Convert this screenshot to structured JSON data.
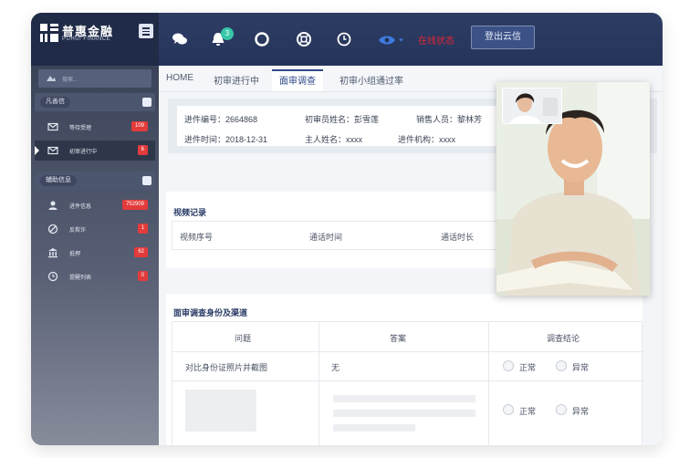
{
  "brand": {
    "name": "普惠金融",
    "sub": "PUHUI FINANCE"
  },
  "header": {
    "notification_count": "3",
    "status_text": "在线状态",
    "logout_label": "登出云信"
  },
  "sidebar": {
    "search_placeholder": "搜索...",
    "sections": [
      {
        "label": "凡善信",
        "items": [
          {
            "label": "等待受理",
            "count": "109"
          },
          {
            "label": "初审进行中",
            "count": "6"
          }
        ]
      },
      {
        "label": "辅助信息",
        "items": [
          {
            "label": "进件信息",
            "count": "752909"
          },
          {
            "label": "反欺诈",
            "count": "1"
          },
          {
            "label": "抵押",
            "count": "62"
          },
          {
            "label": "提醒列表",
            "count": "0"
          }
        ]
      }
    ]
  },
  "tabs": [
    "HOME",
    "初审进行中",
    "面审调查",
    "初审小组通过率"
  ],
  "info": {
    "id_label": "进件编号：",
    "id_value": "2664868",
    "reviewer_label": "初审员姓名：",
    "reviewer_value": "彭雪莲",
    "sales_label": "销售人员：",
    "sales_value": "黎林芳",
    "time_label": "进件时间：",
    "time_value": "2018-12-31",
    "owner_label": "主人姓名：",
    "owner_value": "xxxx",
    "org_label": "进件机构：",
    "org_value": "xxxx"
  },
  "video_records": {
    "title": "视频记录",
    "columns": [
      "视频序号",
      "通话时间",
      "通话时长"
    ]
  },
  "identity_check": {
    "title": "面审调查身份及渠道",
    "columns": [
      "问题",
      "答案",
      "调查结论"
    ],
    "row1": {
      "question": "对比身份证照片并截图",
      "answer": "无"
    },
    "option_normal": "正常",
    "option_abnormal": "异常"
  },
  "colors": {
    "header": "#2b3a60",
    "accent": "#2e4a86",
    "badge_red": "#e33b3b",
    "badge_green": "#37c7a8",
    "status_red": "#e02535"
  }
}
